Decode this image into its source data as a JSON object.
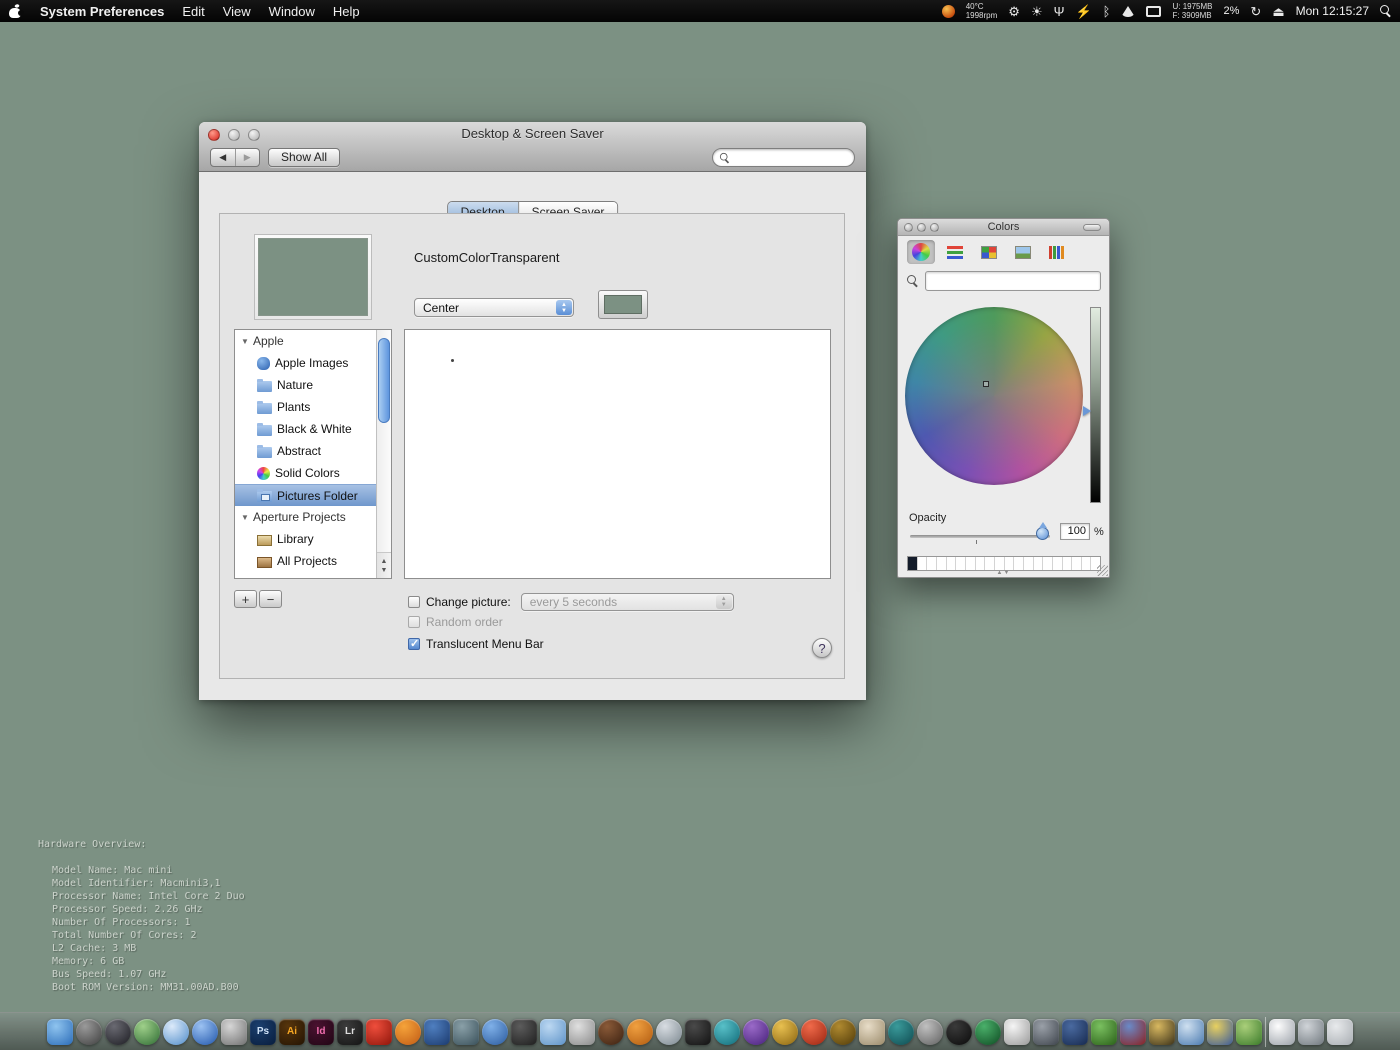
{
  "menu_bar": {
    "app_name": "System Preferences",
    "menus": [
      "Edit",
      "View",
      "Window",
      "Help"
    ],
    "status": {
      "temp": "40°C",
      "fan": "1998rpm",
      "mem_used": "U: 1975MB",
      "mem_free": "F: 3909MB",
      "cpu": "2%",
      "clock": "Mon 12:15:27"
    }
  },
  "prefs_window": {
    "title": "Desktop & Screen Saver",
    "show_all_label": "Show All",
    "search_value": "",
    "tabs": [
      {
        "label": "Desktop",
        "selected": true
      },
      {
        "label": "Screen Saver",
        "selected": false
      }
    ],
    "desktop_tab": {
      "picture_name": "CustomColorTransparent",
      "position_popup_value": "Center",
      "sidebar": [
        {
          "label": "Apple",
          "type": "group"
        },
        {
          "label": "Apple Images",
          "type": "item",
          "icon": "apple"
        },
        {
          "label": "Nature",
          "type": "item",
          "icon": "folder"
        },
        {
          "label": "Plants",
          "type": "item",
          "icon": "folder"
        },
        {
          "label": "Black & White",
          "type": "item",
          "icon": "folder"
        },
        {
          "label": "Abstract",
          "type": "item",
          "icon": "folder"
        },
        {
          "label": "Solid Colors",
          "type": "item",
          "icon": "colors"
        },
        {
          "label": "Pictures Folder",
          "type": "item",
          "icon": "pictures",
          "selected": true
        },
        {
          "label": "Aperture Projects",
          "type": "group"
        },
        {
          "label": "Library",
          "type": "item",
          "icon": "library"
        },
        {
          "label": "All Projects",
          "type": "item",
          "icon": "projects"
        }
      ],
      "add_label": "+",
      "remove_label": "−",
      "change_picture_label": "Change picture:",
      "interval_popup_value": "every 5 seconds",
      "random_order_label": "Random order",
      "translucent_label": "Translucent Menu Bar",
      "help_label": "?"
    }
  },
  "colors_panel": {
    "title": "Colors",
    "search_value": "",
    "opacity_label": "Opacity",
    "opacity_value": "100",
    "percent_label": "%",
    "swatches": [
      {
        "c": "#141c2a"
      },
      {
        "c": "#ffffff"
      },
      {
        "c": "#ffffff"
      },
      {
        "c": "#ffffff"
      },
      {
        "c": "#ffffff"
      },
      {
        "c": "#ffffff"
      },
      {
        "c": "#ffffff"
      },
      {
        "c": "#ffffff"
      },
      {
        "c": "#ffffff"
      },
      {
        "c": "#ffffff"
      },
      {
        "c": "#ffffff"
      },
      {
        "c": "#ffffff"
      },
      {
        "c": "#ffffff"
      },
      {
        "c": "#ffffff"
      },
      {
        "c": "#ffffff"
      },
      {
        "c": "#ffffff"
      },
      {
        "c": "#ffffff"
      },
      {
        "c": "#ffffff"
      },
      {
        "c": "#ffffff"
      },
      {
        "c": "#ffffff"
      }
    ]
  },
  "hardware_overview": {
    "title": "Hardware Overview:",
    "lines": [
      "Model Name: Mac mini",
      "Model Identifier: Macmini3,1",
      "Processor Name: Intel Core 2 Duo",
      "Processor Speed: 2.26 GHz",
      "Number Of Processors: 1",
      "Total Number Of Cores: 2",
      "L2 Cache: 3 MB",
      "Memory: 6 GB",
      "Bus Speed: 1.07 GHz",
      "Boot ROM Version: MM31.00AD.B00"
    ]
  },
  "dock": {
    "items": [
      {
        "name": "finder",
        "color": "#8fc4ef",
        "color2": "#2b6cb8",
        "shape": "square"
      },
      {
        "name": "dial-app",
        "color": "#9a9a9a",
        "color2": "#3f3f3f",
        "shape": "circle"
      },
      {
        "name": "globe-app",
        "color": "#6a6a72",
        "color2": "#1c1c22",
        "shape": "circle"
      },
      {
        "name": "green-app",
        "color": "#9fd08a",
        "color2": "#2e6b33",
        "shape": "circle"
      },
      {
        "name": "safari",
        "color": "#dceafa",
        "color2": "#4f8cc9",
        "shape": "circle"
      },
      {
        "name": "itunes",
        "color": "#9cc2f2",
        "color2": "#1f55ab",
        "shape": "circle"
      },
      {
        "name": "camera-app",
        "color": "#d6d6d6",
        "color2": "#707070",
        "shape": "square"
      },
      {
        "name": "photoshop",
        "label": "Ps",
        "label_color": "#cfe2f7",
        "color": "#1b3f6e",
        "color2": "#081d3d",
        "shape": "square"
      },
      {
        "name": "illustrator",
        "label": "Ai",
        "label_color": "#f5a623",
        "color": "#57350c",
        "color2": "#241403",
        "shape": "square"
      },
      {
        "name": "indesign",
        "label": "Id",
        "label_color": "#f06eae",
        "color": "#4a1230",
        "color2": "#200614",
        "shape": "square"
      },
      {
        "name": "lightroom",
        "label": "Lr",
        "label_color": "#dcdcdc",
        "color": "#3c3c3c",
        "color2": "#141414",
        "shape": "square"
      },
      {
        "name": "acrobat",
        "color": "#ef4e3c",
        "color2": "#8e150a",
        "shape": "square"
      },
      {
        "name": "firefox",
        "color": "#f5a33a",
        "color2": "#c05a14",
        "shape": "circle"
      },
      {
        "name": "blue-app",
        "color": "#4f7fc0",
        "color2": "#1b3a6e",
        "shape": "square"
      },
      {
        "name": "slate-app",
        "color": "#8aa0a8",
        "color2": "#39505a",
        "shape": "square"
      },
      {
        "name": "blue-orb-app",
        "color": "#7fb0e8",
        "color2": "#2a5a9e",
        "shape": "circle"
      },
      {
        "name": "dark-app",
        "color": "#5c5c5c",
        "color2": "#1e1e1e",
        "shape": "square"
      },
      {
        "name": "lightblue-app",
        "color": "#bcd8f2",
        "color2": "#5e93c8",
        "shape": "square"
      },
      {
        "name": "silver-app",
        "color": "#e0e0e0",
        "color2": "#8a8a8a",
        "shape": "square"
      },
      {
        "name": "brown-app",
        "color": "#8a5a38",
        "color2": "#3a2010",
        "shape": "circle"
      },
      {
        "name": "orange-app",
        "color": "#f0a040",
        "color2": "#b05a10",
        "shape": "circle"
      },
      {
        "name": "mail-app",
        "color": "#d8dde2",
        "color2": "#7a868e",
        "shape": "circle"
      },
      {
        "name": "black-camera-app",
        "color": "#4a4a4a",
        "color2": "#111111",
        "shape": "square"
      },
      {
        "name": "teal-swirl-app",
        "color": "#58c0c8",
        "color2": "#106a78",
        "shape": "circle"
      },
      {
        "name": "purple-app",
        "color": "#9a6ac8",
        "color2": "#46207a",
        "shape": "circle"
      },
      {
        "name": "gold-app",
        "color": "#e8c050",
        "color2": "#8a6410",
        "shape": "circle"
      },
      {
        "name": "red-orb-app",
        "color": "#f06a4a",
        "color2": "#9a2410",
        "shape": "circle"
      },
      {
        "name": "darkgold-app",
        "color": "#b08a30",
        "color2": "#503a08",
        "shape": "circle"
      },
      {
        "name": "beige-app",
        "color": "#e8ddc8",
        "color2": "#9a8a6a",
        "shape": "square"
      },
      {
        "name": "teal-app",
        "color": "#3a9a9a",
        "color2": "#0e4a50",
        "shape": "circle"
      },
      {
        "name": "gray-orb-app",
        "color": "#c0c0c0",
        "color2": "#606060",
        "shape": "circle"
      },
      {
        "name": "record-red-app",
        "color": "#3a3a3a",
        "color2": "#0a0a0a",
        "shape": "circle"
      },
      {
        "name": "record-green-app",
        "color": "#4ab06a",
        "color2": "#0e4a22",
        "shape": "circle"
      },
      {
        "name": "piano-app",
        "color": "#f5f5f5",
        "color2": "#9a9a9a",
        "shape": "square"
      },
      {
        "name": "graphite-app",
        "color": "#9aa0a8",
        "color2": "#3e444c",
        "shape": "square"
      },
      {
        "name": "navy-app",
        "color": "#4a6aa0",
        "color2": "#16294e",
        "shape": "square"
      },
      {
        "name": "green-sq-app",
        "color": "#7ac060",
        "color2": "#2a6018",
        "shape": "square"
      },
      {
        "name": "bluered-app",
        "color": "#6a8ac8",
        "color2": "#8a2020",
        "shape": "square"
      },
      {
        "name": "badge-app",
        "color": "#d8b860",
        "color2": "#3a3018",
        "shape": "square"
      },
      {
        "name": "bluedoc-app",
        "color": "#cfe0f0",
        "color2": "#4a7ab0",
        "shape": "square"
      },
      {
        "name": "yellowblue-app",
        "color": "#e8d060",
        "color2": "#3a5a9a",
        "shape": "square"
      },
      {
        "name": "greenpair-app",
        "color": "#aacf7a",
        "color2": "#3a7a2a",
        "shape": "square"
      },
      {
        "sep": true,
        "name": "dock-separator"
      },
      {
        "name": "textedit-doc",
        "color": "#fdfdfd",
        "color2": "#9aa0a8",
        "shape": "square"
      },
      {
        "name": "drive-app",
        "color": "#d0d4d8",
        "color2": "#70787e",
        "shape": "square"
      },
      {
        "name": "trash",
        "color": "#e8eaec",
        "color2": "#a8adb2",
        "shape": "square"
      }
    ]
  }
}
